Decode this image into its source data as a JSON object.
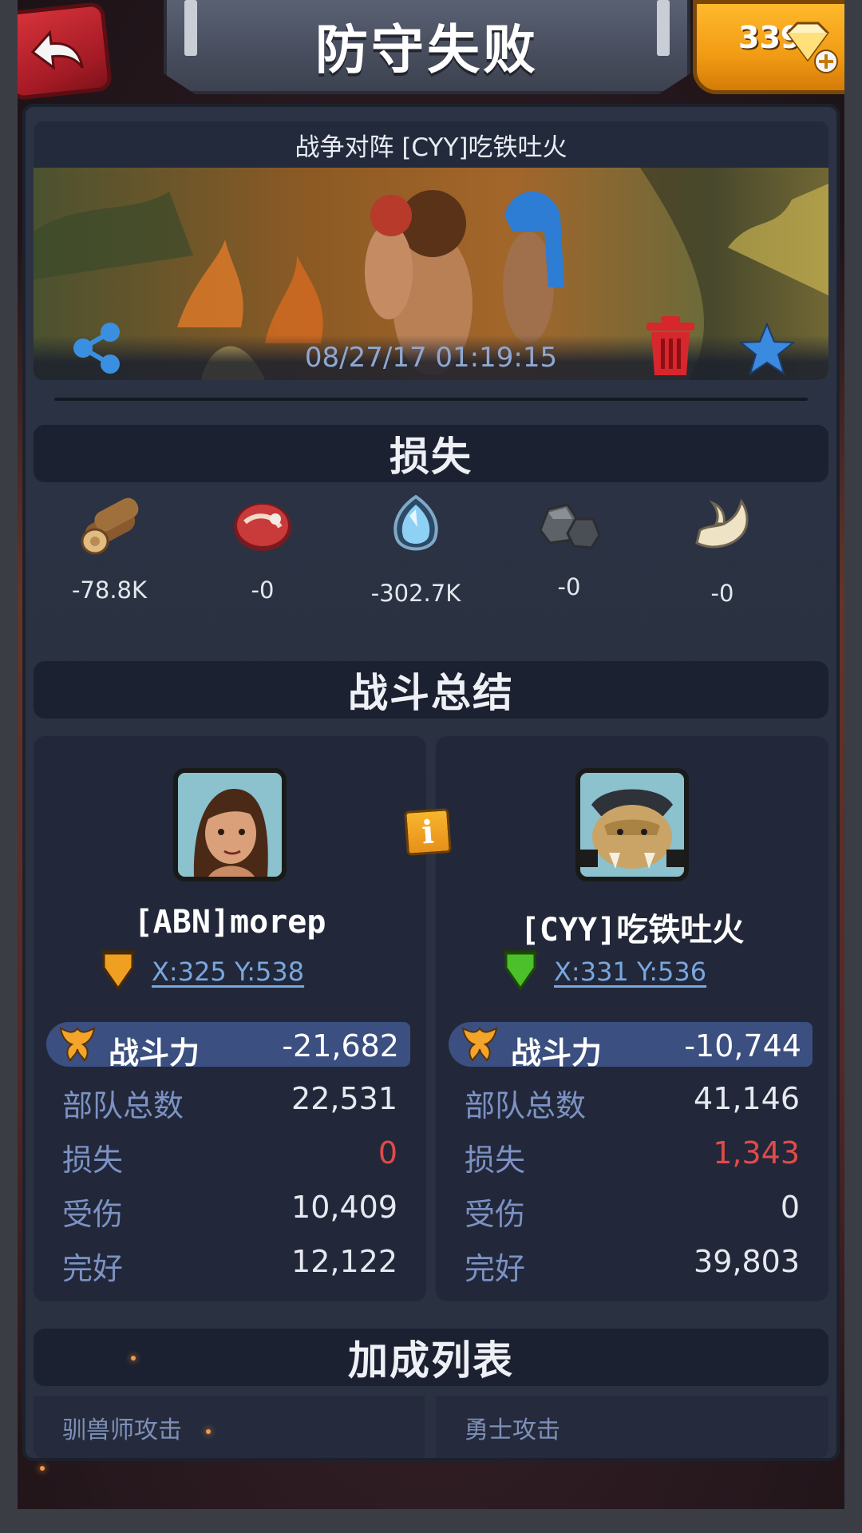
{
  "header": {
    "title": "防守失败",
    "gems": "339"
  },
  "battle": {
    "caption": "战争对阵 [CYY]吃铁吐火",
    "datetime": "08/27/17 01:19:15"
  },
  "losses": {
    "title": "损失",
    "items": [
      {
        "icon": "wood-icon",
        "value": "-78.8K"
      },
      {
        "icon": "meat-icon",
        "value": "-0"
      },
      {
        "icon": "crystal-icon",
        "value": "-302.7K"
      },
      {
        "icon": "stone-icon",
        "value": "-0"
      },
      {
        "icon": "bone-icon",
        "value": "-0"
      }
    ]
  },
  "summary": {
    "title": "战斗总结",
    "left": {
      "name": "[ABN]morep",
      "coords": "X:325 Y:538",
      "power_label": "战斗力",
      "power": "-21,682",
      "stats": [
        {
          "label": "部队总数",
          "value": "22,531"
        },
        {
          "label": "损失",
          "value": "0"
        },
        {
          "label": "受伤",
          "value": "10,409"
        },
        {
          "label": "完好",
          "value": "12,122"
        }
      ]
    },
    "right": {
      "name": "[CYY]吃铁吐火",
      "coords": "X:331 Y:536",
      "power_label": "战斗力",
      "power": "-10,744",
      "stats": [
        {
          "label": "部队总数",
          "value": "41,146"
        },
        {
          "label": "损失",
          "value": "1,343"
        },
        {
          "label": "受伤",
          "value": "0"
        },
        {
          "label": "完好",
          "value": "39,803"
        }
      ]
    },
    "info_label": "i"
  },
  "bonus": {
    "title": "加成列表",
    "left": "驯兽师攻击",
    "right": "勇士攻击"
  },
  "colors": {
    "loss_red": "#e24a4a",
    "stat_label": "#7c92c4",
    "power_bar": "#3b4f80",
    "gem_gold": "#f19b14",
    "back_red": "#c4252e"
  }
}
